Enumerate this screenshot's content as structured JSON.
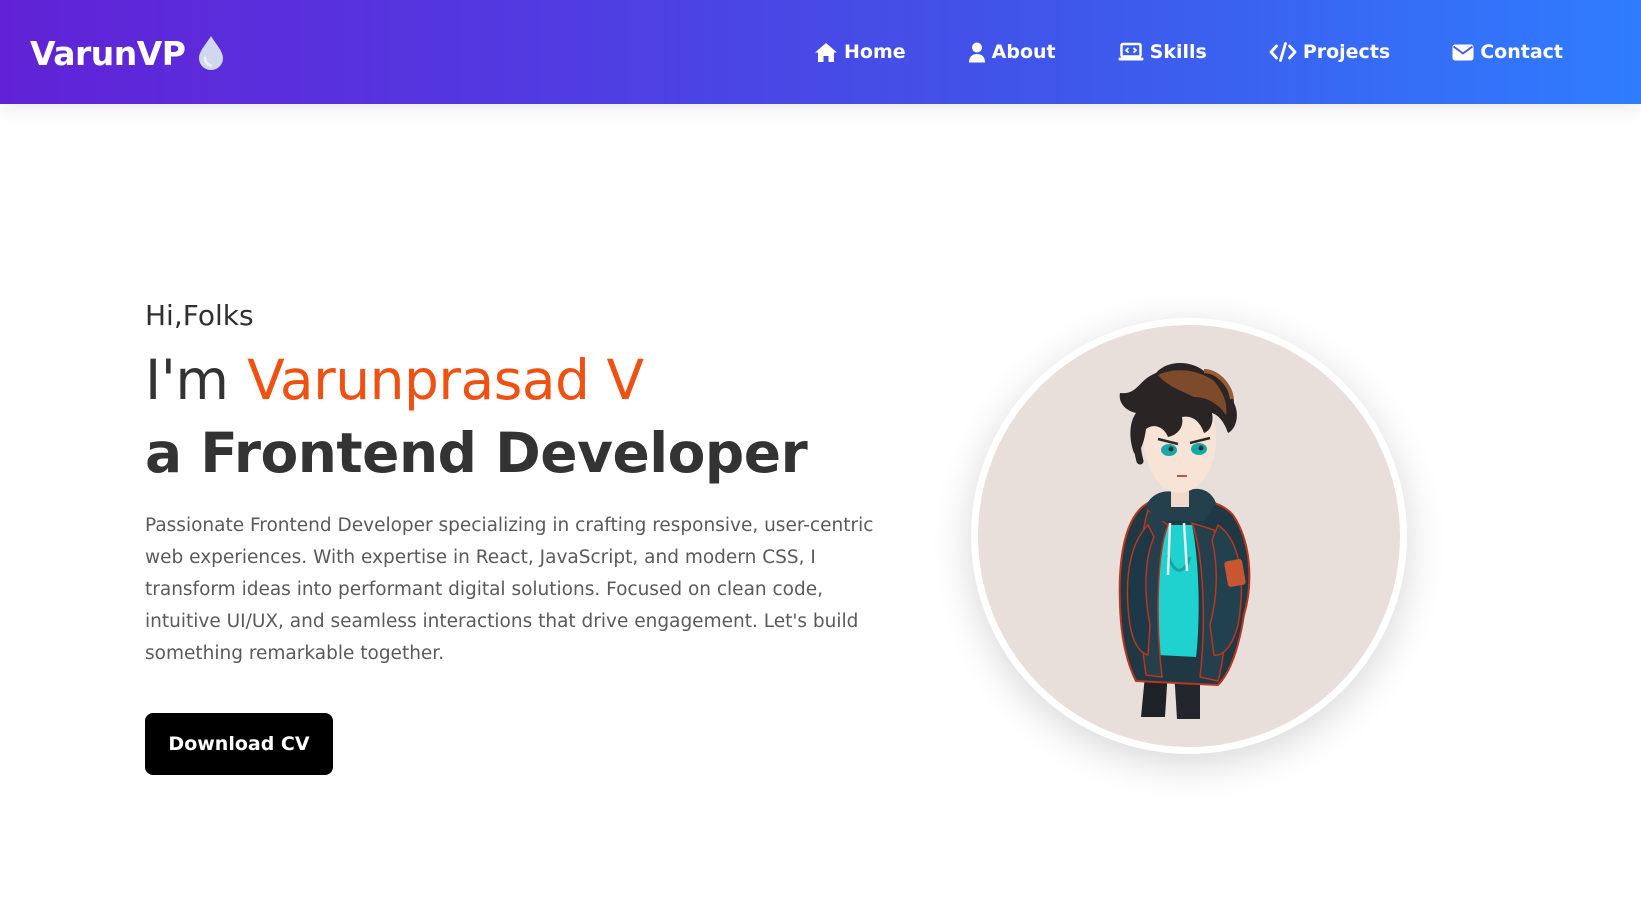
{
  "header": {
    "brand": "VarunVP",
    "brand_icon": "droplet-icon",
    "nav": [
      {
        "label": "Home",
        "icon": "home-icon"
      },
      {
        "label": "About",
        "icon": "user-icon"
      },
      {
        "label": "Skills",
        "icon": "laptop-code-icon"
      },
      {
        "label": "Projects",
        "icon": "code-icon"
      },
      {
        "label": "Contact",
        "icon": "envelope-icon"
      }
    ],
    "gradient": [
      "#6122d6",
      "#2f7cff"
    ]
  },
  "hero": {
    "greeting": "Hi,Folks",
    "intro_prefix": "I'm",
    "name": "Varunprasad V",
    "role_line": "a Frontend Developer",
    "description": "Passionate Frontend Developer specializing in crafting responsive, user-centric web experiences. With expertise in React, JavaScript, and modern CSS, I transform ideas into performant digital solutions. Focused on clean code, intuitive UI/UX, and seamless interactions that drive engagement. Let's build something remarkable together.",
    "cv_button": "Download CV",
    "accent_color": "#ef5112",
    "avatar": "anime-boy-avatar"
  }
}
